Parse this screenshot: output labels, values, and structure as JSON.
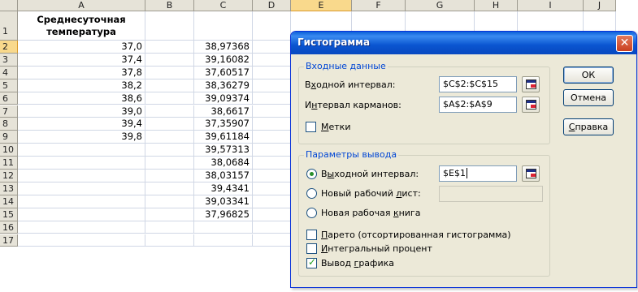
{
  "sheet": {
    "columns": [
      "A",
      "B",
      "C",
      "D",
      "E",
      "F",
      "G",
      "H",
      "I",
      "J"
    ],
    "rows": [
      "1",
      "2",
      "3",
      "4",
      "5",
      "6",
      "7",
      "8",
      "9",
      "10",
      "11",
      "12",
      "13",
      "14",
      "15",
      "16",
      "17"
    ],
    "a1_line1": "Среднесуточная",
    "a1_line2": "температура",
    "col_a": [
      "37,0",
      "37,4",
      "37,8",
      "38,2",
      "38,6",
      "39,0",
      "39,4",
      "39,8"
    ],
    "col_c": [
      "38,97368",
      "39,16082",
      "37,60517",
      "38,36279",
      "39,09374",
      "38,6617",
      "37,35907",
      "39,61184",
      "39,57313",
      "38,0684",
      "38,03157",
      "39,4341",
      "39,03341",
      "37,96825"
    ]
  },
  "dialog": {
    "title": "Гистограмма",
    "close_glyph": "✕",
    "input_group": {
      "title": "Входные данные",
      "input_range_label_pre": "В",
      "input_range_label_u": "х",
      "input_range_label_post": "одной интервал:",
      "input_range_value": "$C$2:$C$15",
      "bin_range_label_pre": "И",
      "bin_range_label_u": "н",
      "bin_range_label_post": "тервал карманов:",
      "bin_range_value": "$A$2:$A$9",
      "labels_label_u": "М",
      "labels_label_post": "етки",
      "labels_checked": false
    },
    "output_group": {
      "title": "Параметры вывода",
      "output_range_label_pre": "В",
      "output_range_label_u": "ы",
      "output_range_label_post": "ходной интервал:",
      "output_range_value": "$E$1",
      "output_range_selected": true,
      "new_sheet_label_pre": "Новый рабочий ",
      "new_sheet_label_u": "л",
      "new_sheet_label_post": "ист:",
      "new_sheet_value": "",
      "new_book_label_pre": "Новая рабочая ",
      "new_book_label_u": "к",
      "new_book_label_post": "нига",
      "pareto_label_u": "П",
      "pareto_label_post": "арето (отсортированная гистограмма)",
      "pareto_checked": false,
      "cumulative_label_u": "И",
      "cumulative_label_post": "нтегральный процент",
      "cumulative_checked": false,
      "chart_label_pre": "Вывод ",
      "chart_label_u": "г",
      "chart_label_post": "рафика",
      "chart_checked": true
    },
    "buttons": {
      "ok": "ОК",
      "cancel": "Отмена",
      "help_u": "С",
      "help_post": "правка"
    }
  }
}
